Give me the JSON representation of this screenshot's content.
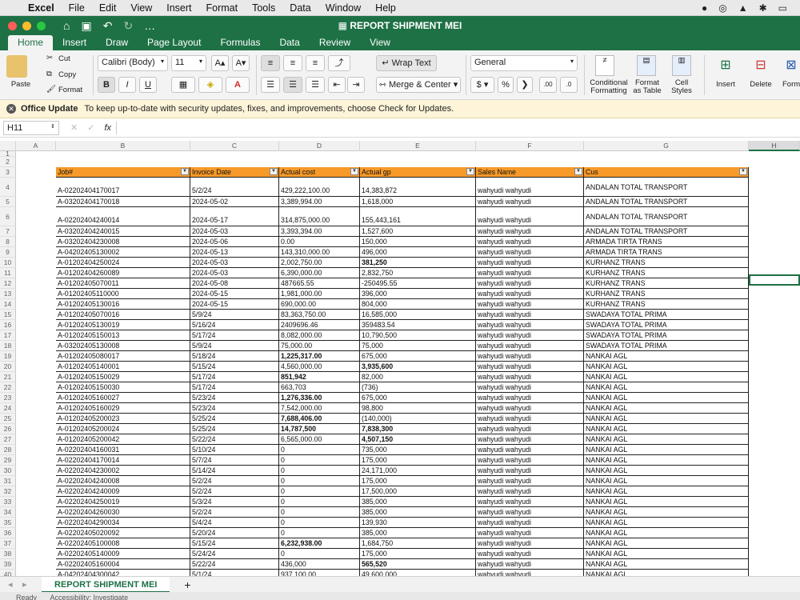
{
  "menubar": {
    "apple": "",
    "app": "Excel",
    "items": [
      "File",
      "Edit",
      "View",
      "Insert",
      "Format",
      "Tools",
      "Data",
      "Window",
      "Help"
    ]
  },
  "window": {
    "title": "REPORT SHIPMENT MEI"
  },
  "tabs": [
    "Home",
    "Insert",
    "Draw",
    "Page Layout",
    "Formulas",
    "Data",
    "Review",
    "View"
  ],
  "ribbon": {
    "paste": "Paste",
    "cut": "Cut",
    "copy": "Copy",
    "format": "Format",
    "font_name": "Calibri (Body)",
    "font_size": "11",
    "wrap_text": "Wrap Text",
    "merge_center": "Merge & Center",
    "number_format": "General",
    "conditional": "Conditional Formatting",
    "format_table": "Format as Table",
    "cell_styles": "Cell Styles",
    "insert": "Insert",
    "delete": "Delete",
    "format_cells": "Form",
    "bold": "B",
    "italic": "I",
    "underline": "U"
  },
  "update": {
    "title": "Office Update",
    "message": "To keep up-to-date with security updates, fixes, and improvements, choose Check for Updates."
  },
  "formula_bar": {
    "name_box": "H11",
    "fx": "fx"
  },
  "columns": [
    "A",
    "B",
    "C",
    "D",
    "E",
    "F",
    "G",
    "H"
  ],
  "headers": [
    "Job#",
    "Invoice Date",
    "Actual cost",
    "Actual gp",
    "Sales Name",
    "Cus"
  ],
  "rows": [
    {
      "n": "4",
      "job": "A-02202404170017",
      "date": "5/2/24",
      "cost": "429,222,100.00",
      "gp": "14,383,872",
      "sales": "wahyudi  wahyudi",
      "cus": "ANDALAN TOTAL TRANSPORT",
      "tall": true
    },
    {
      "n": "5",
      "job": "A-03202404170018",
      "date": "2024-05-02",
      "cost": "3,389,994.00",
      "gp": "1,618,000",
      "sales": "wahyudi  wahyudi",
      "cus": "ANDALAN TOTAL  TRANSPORT"
    },
    {
      "n": "6",
      "job": "A-02202404240014",
      "date": "2024-05-17",
      "cost": "314,875,000.00",
      "gp": "155,443,161",
      "sales": "wahyudi  wahyudi",
      "cus": "ANDALAN TOTAL TRANSPORT",
      "tall": true
    },
    {
      "n": "7",
      "job": "A-03202404240015",
      "date": "2024-05-03",
      "cost": "3,393,394.00",
      "gp": "1,527,600",
      "sales": "wahyudi  wahyudi",
      "cus": "ANDALAN TOTAL  TRANSPORT"
    },
    {
      "n": "8",
      "job": "A-03202404230008",
      "date": "2024-05-06",
      "cost": "0.00",
      "gp": "150,000",
      "sales": "wahyudi  wahyudi",
      "cus": "ARMADA TIRTA TRANS"
    },
    {
      "n": "9",
      "job": "A-04202405130002",
      "date": "2024-05-13",
      "cost": "143,310,000.00",
      "gp": "496,000",
      "sales": "wahyudi  wahyudi",
      "cus": "ARMADA TIRTA TRANS"
    },
    {
      "n": "10",
      "job": "A-01202404250024",
      "date": "2024-05-03",
      "cost": "2,002,750.00",
      "gp": "381,250",
      "sales": "wahyudi  wahyudi",
      "cus": "KURHANZ TRANS",
      "gpb": true
    },
    {
      "n": "11",
      "job": " A-01202404260089",
      "date": "2024-05-03",
      "cost": "6,390,000.00",
      "gp": "2,832,750",
      "sales": "wahyudi  wahyudi",
      "cus": "KURHANZ TRANS"
    },
    {
      "n": "12",
      "job": "A-01202405070011",
      "date": "2024-05-08",
      "cost": "487665.55",
      "gp": "-250495.55",
      "sales": "wahyudi  wahyudi",
      "cus": "KURHANZ TRANS"
    },
    {
      "n": "13",
      "job": "A-01202405110000",
      "date": "2024-05-15",
      "cost": "1,981,000.00",
      "gp": "396,000",
      "sales": "wahyudi  wahyudi",
      "cus": "KURHANZ TRANS"
    },
    {
      "n": "14",
      "job": "A-01202405130016",
      "date": "2024-05-15",
      "cost": "690,000.00",
      "gp": "804,000",
      "sales": "wahyudi  wahyudi",
      "cus": "KURHANZ TRANS"
    },
    {
      "n": "15",
      "job": "A-01202405070016",
      "date": "5/9/24",
      "cost": "83,363,750.00",
      "gp": "16,585,000",
      "sales": "wahyudi  wahyudi",
      "cus": "SWADAYA TOTAL PRIMA"
    },
    {
      "n": "16",
      "job": "A-01202405130019",
      "date": "5/16/24",
      "cost": "2409696.46",
      "gp": "359483.54",
      "sales": "wahyudi  wahyudi",
      "cus": "SWADAYA TOTAL PRIMA"
    },
    {
      "n": "17",
      "job": "A-01202405150013",
      "date": "5/17/24",
      "cost": "8,082,000.00",
      "gp": "10,790,500",
      "sales": "wahyudi  wahyudi",
      "cus": "SWADAYA TOTAL PRIMA"
    },
    {
      "n": "18",
      "job": "A-03202405130008",
      "date": "5/9/24",
      "cost": "75,000.00",
      "gp": "75,000",
      "sales": "wahyudi  wahyudi",
      "cus": "SWADAYA TOTAL PRIMA"
    },
    {
      "n": "19",
      "job": "A-01202405080017",
      "date": "5/18/24",
      "cost": "1,225,317.00",
      "gp": "675,000",
      "sales": "wahyudi  wahyudi",
      "cus": "NANKAI AGL",
      "costb": true
    },
    {
      "n": "20",
      "job": "A-01202405140001",
      "date": "5/15/24",
      "cost": "4,560,000.00",
      "gp": "3,935,600",
      "sales": "wahyudi  wahyudi",
      "cus": "NANKAI AGL",
      "gpb": true
    },
    {
      "n": "21",
      "job": "A-01202405150029",
      "date": "5/17/24",
      "cost": "851,942",
      "gp": "82,000",
      "sales": "wahyudi  wahyudi",
      "cus": "NANKAI AGL",
      "costb": true
    },
    {
      "n": "22",
      "job": "A-01202405150030",
      "date": "5/17/24",
      "cost": "663,703",
      "gp": "(736)",
      "sales": "wahyudi  wahyudi",
      "cus": "NANKAI AGL"
    },
    {
      "n": "23",
      "job": "A-01202405160027",
      "date": "5/23/24",
      "cost": "1,276,336.00",
      "gp": "675,000",
      "sales": "wahyudi  wahyudi",
      "cus": "NANKAI AGL",
      "costb": true
    },
    {
      "n": "24",
      "job": "A-01202405160029",
      "date": "5/23/24",
      "cost": "7,542,000.00",
      "gp": "98,800",
      "sales": "wahyudi  wahyudi",
      "cus": "NANKAI AGL"
    },
    {
      "n": "25",
      "job": "A-01202405200023",
      "date": "5/25/24",
      "cost": "7,688,406.00",
      "gp": "(140,000)",
      "sales": "wahyudi  wahyudi",
      "cus": "NANKAI AGL",
      "costb": true
    },
    {
      "n": "26",
      "job": "A-01202405200024",
      "date": "5/25/24",
      "cost": "14,787,500",
      "gp": "7,838,300",
      "sales": "wahyudi  wahyudi",
      "cus": "NANKAI AGL",
      "costb": true,
      "gpb": true
    },
    {
      "n": "27",
      "job": "A-01202405200042",
      "date": "5/22/24",
      "cost": "6,565,000.00",
      "gp": "4,507,150",
      "sales": "wahyudi  wahyudi",
      "cus": "NANKAI AGL",
      "gpb": true
    },
    {
      "n": "28",
      "job": "A-02202404160031",
      "date": "5/10/24",
      "cost": "0",
      "gp": "735,000",
      "sales": "wahyudi  wahyudi",
      "cus": "NANKAI AGL"
    },
    {
      "n": "29",
      "job": "A-02202404170014",
      "date": "5/7/24",
      "cost": "0",
      "gp": "175,000",
      "sales": "wahyudi  wahyudi",
      "cus": "NANKAI AGL"
    },
    {
      "n": "30",
      "job": "A-02202404230002",
      "date": "5/14/24",
      "cost": "0",
      "gp": "24,171,000",
      "sales": "wahyudi  wahyudi",
      "cus": "NANKAI AGL"
    },
    {
      "n": "31",
      "job": "A-02202404240008",
      "date": "5/2/24",
      "cost": "0",
      "gp": "175,000",
      "sales": "wahyudi  wahyudi",
      "cus": "NANKAI AGL"
    },
    {
      "n": "32",
      "job": "A-02202404240009",
      "date": "5/2/24",
      "cost": "0",
      "gp": "17,500,000",
      "sales": "wahyudi  wahyudi",
      "cus": "NANKAI AGL"
    },
    {
      "n": "33",
      "job": "A-02202404250019",
      "date": "5/3/24",
      "cost": "0",
      "gp": "385,000",
      "sales": "wahyudi  wahyudi",
      "cus": "NANKAI AGL"
    },
    {
      "n": "34",
      "job": "A-02202404260030",
      "date": "5/2/24",
      "cost": "0",
      "gp": "385,000",
      "sales": "wahyudi  wahyudi",
      "cus": "NANKAI AGL"
    },
    {
      "n": "35",
      "job": "A-02202404290034",
      "date": "5/4/24",
      "cost": "0",
      "gp": "139,930",
      "sales": "wahyudi  wahyudi",
      "cus": "NANKAI AGL"
    },
    {
      "n": "36",
      "job": "A-02202405020092",
      "date": "5/20/24",
      "cost": "0",
      "gp": "385,000",
      "sales": "wahyudi  wahyudi",
      "cus": "NANKAI AGL"
    },
    {
      "n": "37",
      "job": "A-02202405100008",
      "date": "5/15/24",
      "cost": "6,232,938.00",
      "gp": "1,684,750",
      "sales": "wahyudi  wahyudi",
      "cus": "NANKAI AGL",
      "costb": true
    },
    {
      "n": "38",
      "job": "A-02202405140009",
      "date": "5/24/24",
      "cost": "0",
      "gp": "175,000",
      "sales": "wahyudi  wahyudi",
      "cus": "NANKAI AGL"
    },
    {
      "n": "39",
      "job": "A-02202405160004",
      "date": "5/22/24",
      "cost": "436,000",
      "gp": "565,520",
      "sales": "wahyudi  wahyudi",
      "cus": "NANKAI AGL",
      "gpb": true
    },
    {
      "n": "40",
      "job": "A-04202404300042",
      "date": "5/1/24",
      "cost": "937,100.00",
      "gp": "49,600,000",
      "sales": "wahyudi  wahyudi",
      "cus": "NANKAI AGL"
    }
  ],
  "sheet": {
    "tab": "REPORT SHIPMENT MEI",
    "add": "+"
  },
  "status": {
    "ready": "Ready",
    "accessibility": "Accessibility: Investigate"
  }
}
